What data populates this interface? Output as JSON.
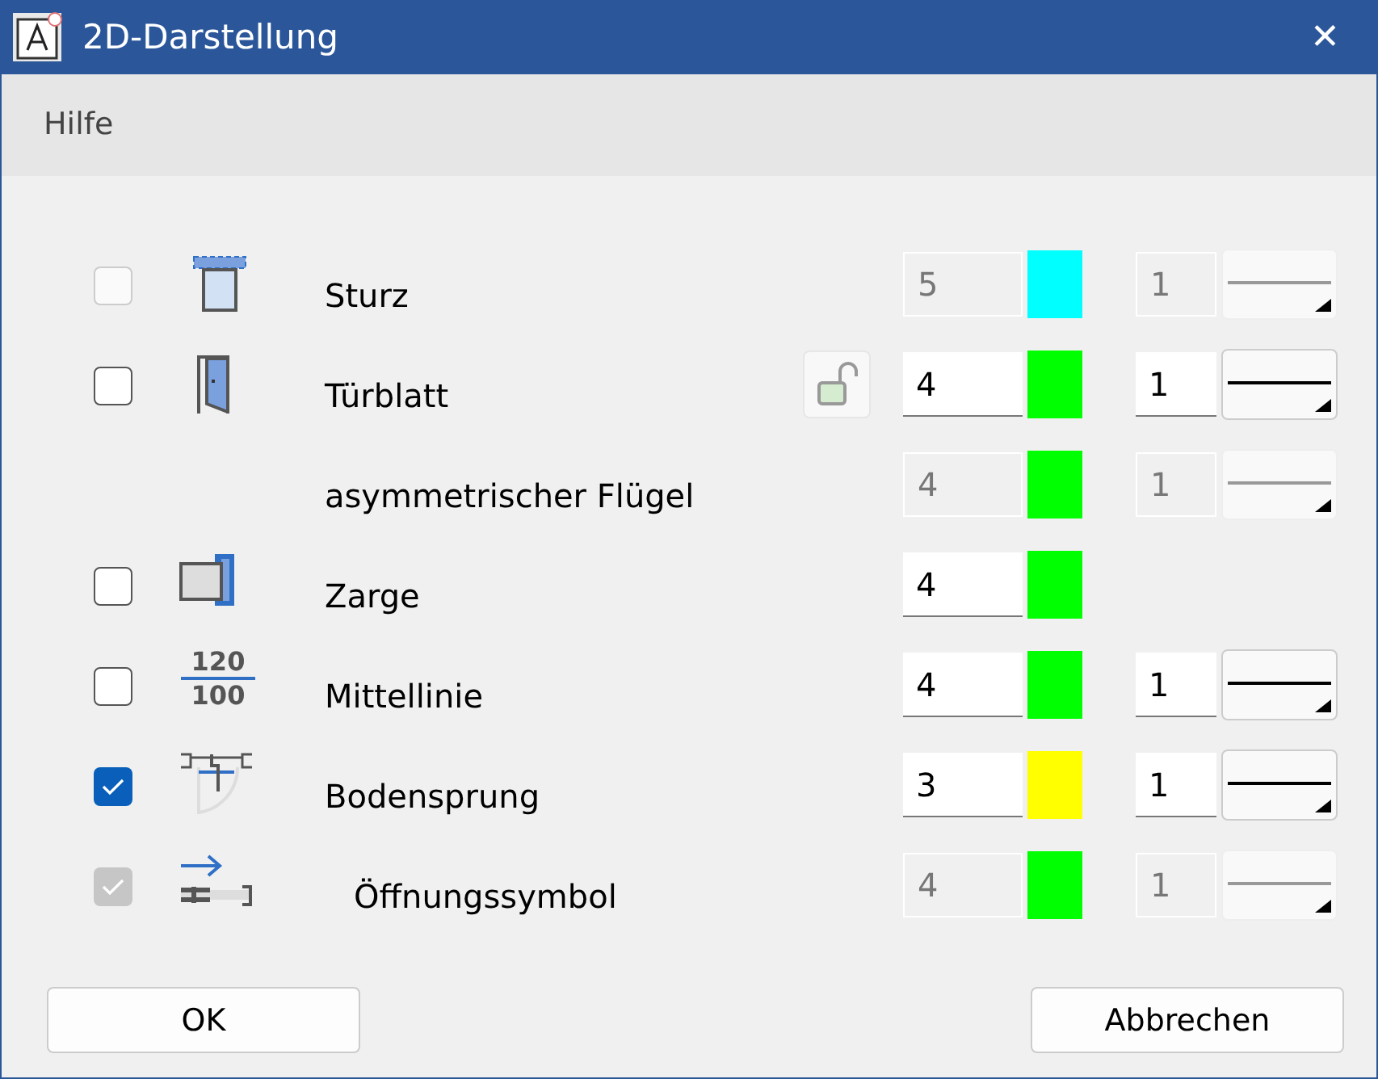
{
  "window": {
    "title": "2D-Darstellung",
    "close": "✕"
  },
  "menu": [
    "Hilfe"
  ],
  "rows": [
    {
      "checkbox": {
        "checked": false,
        "disabled": true
      },
      "kind": "lintel",
      "label": "Sturz",
      "indented": false,
      "pen": {
        "value": "5",
        "disabled": true
      },
      "color": "#00ffff",
      "weight": {
        "value": "1",
        "disabled": true
      },
      "line": {
        "disabled": true
      }
    },
    {
      "checkbox": {
        "checked": false,
        "disabled": false
      },
      "kind": "door",
      "label": "Türblatt",
      "indented": false,
      "lock": true,
      "pen": {
        "value": "4",
        "disabled": false
      },
      "color": "#00ff00",
      "weight": {
        "value": "1",
        "disabled": false
      },
      "line": {
        "disabled": false
      }
    },
    {
      "label": "asymmetrischer Flügel",
      "indented": false,
      "pen": {
        "value": "4",
        "disabled": true
      },
      "color": "#00ff00",
      "weight": {
        "value": "1",
        "disabled": true
      },
      "line": {
        "disabled": true
      }
    },
    {
      "checkbox": {
        "checked": false,
        "disabled": false
      },
      "kind": "frame",
      "label": "Zarge",
      "indented": false,
      "pen": {
        "value": "4",
        "disabled": false
      },
      "color": "#00ff00"
    },
    {
      "checkbox": {
        "checked": false,
        "disabled": false
      },
      "kind": "numbers",
      "icon_texts": [
        "120",
        "100"
      ],
      "label": "Mittellinie",
      "indented": false,
      "pen": {
        "value": "4",
        "disabled": false
      },
      "color": "#00ff00",
      "weight": {
        "value": "1",
        "disabled": false
      },
      "line": {
        "disabled": false
      }
    },
    {
      "checkbox": {
        "checked": true,
        "disabled": false
      },
      "kind": "threshold",
      "label": "Bodensprung",
      "indented": false,
      "pen": {
        "value": "3",
        "disabled": false
      },
      "color": "#ffff00",
      "weight": {
        "value": "1",
        "disabled": false
      },
      "line": {
        "disabled": false
      }
    },
    {
      "checkbox": {
        "checked": true,
        "disabled": true
      },
      "kind": "opening",
      "label": "Öffnungssymbol",
      "indented": true,
      "pen": {
        "value": "4",
        "disabled": true
      },
      "color": "#00ff00",
      "weight": {
        "value": "1",
        "disabled": true
      },
      "line": {
        "disabled": true
      }
    }
  ],
  "buttons": [
    "OK",
    "Abbrechen"
  ]
}
